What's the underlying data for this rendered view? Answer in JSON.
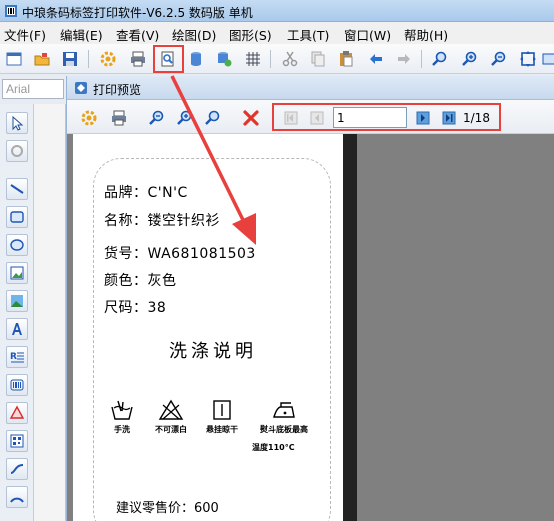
{
  "window": {
    "title": "中琅条码标签打印软件-V6.2.5 数码版 单机"
  },
  "menu": [
    {
      "label": "文件(F)"
    },
    {
      "label": "编辑(E)"
    },
    {
      "label": "查看(V)"
    },
    {
      "label": "绘图(D)"
    },
    {
      "label": "图形(S)"
    },
    {
      "label": "工具(T)"
    },
    {
      "label": "窗口(W)"
    },
    {
      "label": "帮助(H)"
    }
  ],
  "font_box": {
    "value": "Arial"
  },
  "preview": {
    "title": "打印预览",
    "page_input": "1",
    "page_count": "1/18"
  },
  "label": {
    "fields": [
      {
        "text": "品牌：C'N'C"
      },
      {
        "text": "名称：镂空针织衫"
      },
      {
        "text": "货号：WA681081503"
      },
      {
        "text": "颜色：灰色"
      },
      {
        "text": "尺码：38"
      }
    ],
    "care_title": "洗涤说明",
    "care_items": [
      {
        "label": "手洗"
      },
      {
        "label": "不可漂白"
      },
      {
        "label": "悬挂晾干"
      },
      {
        "label": "熨斗底板最高"
      }
    ],
    "care_extra": "温度110°C",
    "price": "建议零售价：600"
  },
  "colors": {
    "highlight": "#e8403d",
    "accent": "#2f6fc6"
  }
}
